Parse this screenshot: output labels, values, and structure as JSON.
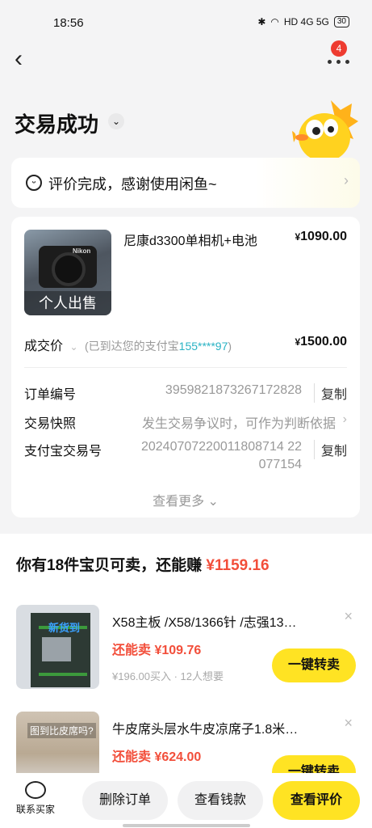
{
  "status_bar": {
    "time": "18:56",
    "indicators": "HD 4G 5G",
    "battery": "30"
  },
  "header": {
    "badge_count": "4",
    "title": "交易成功"
  },
  "review": {
    "text": "评价完成，感谢使用闲鱼~"
  },
  "order": {
    "product_name": "尼康d3300单相机+电池",
    "product_price": "1090.00",
    "image_label": "个人出售",
    "image_brand": "Nikon",
    "deal_label": "成交价",
    "deal_note_prefix": "(已到达您的支付宝",
    "deal_phone": "155****97",
    "deal_note_suffix": ")",
    "deal_price": "1500.00",
    "fields": [
      {
        "key": "订单编号",
        "value": "3959821873267172828",
        "action": "复制"
      },
      {
        "key": "交易快照",
        "value": "发生交易争议时，可作为判断依据"
      },
      {
        "key": "支付宝交易号",
        "value_line1": "20240707220011808714 22",
        "value_line2": "077154",
        "action": "复制"
      }
    ],
    "see_more": "查看更多"
  },
  "resell": {
    "headline_prefix": "你有18件宝贝可卖，还能赚",
    "headline_amount": "¥1159.16",
    "items": [
      {
        "name": "X58主板 /X58/1366针 /志强13…",
        "sell_label": "还能卖 ¥109.76",
        "meta": "¥196.00买入 · 12人想要",
        "button": "一键转卖",
        "image_tag": "新货到"
      },
      {
        "name": "牛皮席头层水牛皮凉席子1.8米…",
        "sell_label": "还能卖 ¥624.00",
        "button": "一键转卖",
        "image_tag": "图到比皮席吗?"
      }
    ]
  },
  "bottom_bar": {
    "contact": "联系买家",
    "delete": "删除订单",
    "view_money": "查看钱款",
    "view_review": "查看评价"
  },
  "colors": {
    "accent_yellow": "#ffe323",
    "price_red": "#f24e3a",
    "phone_teal": "#2ab3c4"
  }
}
